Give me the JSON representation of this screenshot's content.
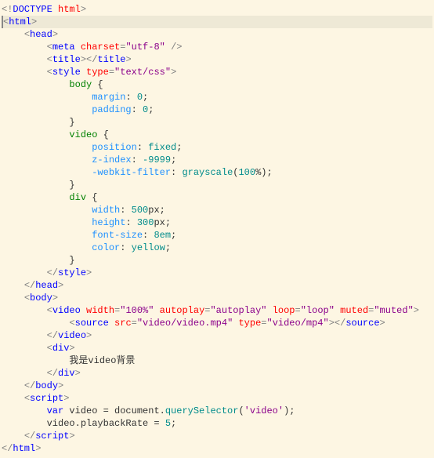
{
  "lines": [
    [
      [
        0,
        "&lt;!",
        "gray"
      ],
      [
        0,
        "DOCTYPE",
        "blue"
      ],
      [
        0,
        " ",
        "black"
      ],
      [
        0,
        "html",
        "red"
      ],
      [
        0,
        "&gt;",
        "gray"
      ]
    ],
    [
      [
        0,
        "&lt;",
        "gray"
      ],
      [
        0,
        "html",
        "blue"
      ],
      [
        0,
        "&gt;",
        "gray"
      ]
    ],
    [
      [
        4,
        "&lt;",
        "gray"
      ],
      [
        0,
        "head",
        "blue"
      ],
      [
        0,
        "&gt;",
        "gray"
      ]
    ],
    [
      [
        8,
        "&lt;",
        "gray"
      ],
      [
        0,
        "meta",
        "blue"
      ],
      [
        0,
        " ",
        "black"
      ],
      [
        0,
        "charset",
        "red"
      ],
      [
        0,
        "=",
        "gray"
      ],
      [
        0,
        "\"utf-8\"",
        "purple"
      ],
      [
        0,
        " /&gt;",
        "gray"
      ]
    ],
    [
      [
        8,
        "&lt;",
        "gray"
      ],
      [
        0,
        "title",
        "blue"
      ],
      [
        0,
        "&gt;&lt;/",
        "gray"
      ],
      [
        0,
        "title",
        "blue"
      ],
      [
        0,
        "&gt;",
        "gray"
      ]
    ],
    [
      [
        8,
        "&lt;",
        "gray"
      ],
      [
        0,
        "style",
        "blue"
      ],
      [
        0,
        " ",
        "black"
      ],
      [
        0,
        "type",
        "red"
      ],
      [
        0,
        "=",
        "gray"
      ],
      [
        0,
        "\"text/css\"",
        "purple"
      ],
      [
        0,
        "&gt;",
        "gray"
      ]
    ],
    [
      [
        12,
        "body",
        "green"
      ],
      [
        0,
        " {",
        "black"
      ]
    ],
    [
      [
        16,
        "margin",
        "lblue"
      ],
      [
        0,
        ": ",
        "black"
      ],
      [
        0,
        "0",
        "teal"
      ],
      [
        0,
        ";",
        "black"
      ]
    ],
    [
      [
        16,
        "padding",
        "lblue"
      ],
      [
        0,
        ": ",
        "black"
      ],
      [
        0,
        "0",
        "teal"
      ],
      [
        0,
        ";",
        "black"
      ]
    ],
    [
      [
        12,
        "}",
        "black"
      ]
    ],
    [
      [
        12,
        "video",
        "green"
      ],
      [
        0,
        " {",
        "black"
      ]
    ],
    [
      [
        16,
        "position",
        "lblue"
      ],
      [
        0,
        ": ",
        "black"
      ],
      [
        0,
        "fixed",
        "teal"
      ],
      [
        0,
        ";",
        "black"
      ]
    ],
    [
      [
        16,
        "z-index",
        "lblue"
      ],
      [
        0,
        ": ",
        "black"
      ],
      [
        0,
        "-9999",
        "teal"
      ],
      [
        0,
        ";",
        "black"
      ]
    ],
    [
      [
        16,
        "-webkit-filter",
        "lblue"
      ],
      [
        0,
        ": ",
        "black"
      ],
      [
        0,
        "grayscale",
        "teal"
      ],
      [
        0,
        "(",
        "black"
      ],
      [
        0,
        "100",
        "teal"
      ],
      [
        0,
        "%);",
        "black"
      ]
    ],
    [
      [
        12,
        "}",
        "black"
      ]
    ],
    [
      [
        12,
        "div",
        "green"
      ],
      [
        0,
        " {",
        "black"
      ]
    ],
    [
      [
        16,
        "width",
        "lblue"
      ],
      [
        0,
        ": ",
        "black"
      ],
      [
        0,
        "500",
        "teal"
      ],
      [
        0,
        "px;",
        "black"
      ]
    ],
    [
      [
        16,
        "height",
        "lblue"
      ],
      [
        0,
        ": ",
        "black"
      ],
      [
        0,
        "300",
        "teal"
      ],
      [
        0,
        "px;",
        "black"
      ]
    ],
    [
      [
        16,
        "font-size",
        "lblue"
      ],
      [
        0,
        ": ",
        "black"
      ],
      [
        0,
        "8em",
        "teal"
      ],
      [
        0,
        ";",
        "black"
      ]
    ],
    [
      [
        16,
        "color",
        "lblue"
      ],
      [
        0,
        ": ",
        "black"
      ],
      [
        0,
        "yellow",
        "teal"
      ],
      [
        0,
        ";",
        "black"
      ]
    ],
    [
      [
        12,
        "}",
        "black"
      ]
    ],
    [
      [
        8,
        "&lt;/",
        "gray"
      ],
      [
        0,
        "style",
        "blue"
      ],
      [
        0,
        "&gt;",
        "gray"
      ]
    ],
    [
      [
        4,
        "&lt;/",
        "gray"
      ],
      [
        0,
        "head",
        "blue"
      ],
      [
        0,
        "&gt;",
        "gray"
      ]
    ],
    [
      [
        4,
        "&lt;",
        "gray"
      ],
      [
        0,
        "body",
        "blue"
      ],
      [
        0,
        "&gt;",
        "gray"
      ]
    ],
    [
      [
        8,
        "&lt;",
        "gray"
      ],
      [
        0,
        "video",
        "blue"
      ],
      [
        0,
        " ",
        "black"
      ],
      [
        0,
        "width",
        "red"
      ],
      [
        0,
        "=",
        "gray"
      ],
      [
        0,
        "\"100%\"",
        "purple"
      ],
      [
        0,
        " ",
        "black"
      ],
      [
        0,
        "autoplay",
        "red"
      ],
      [
        0,
        "=",
        "gray"
      ],
      [
        0,
        "\"autoplay\"",
        "purple"
      ],
      [
        0,
        " ",
        "black"
      ],
      [
        0,
        "loop",
        "red"
      ],
      [
        0,
        "=",
        "gray"
      ],
      [
        0,
        "\"loop\"",
        "purple"
      ],
      [
        0,
        " ",
        "black"
      ],
      [
        0,
        "muted",
        "red"
      ],
      [
        0,
        "=",
        "gray"
      ],
      [
        0,
        "\"muted\"",
        "purple"
      ],
      [
        0,
        "&gt;",
        "gray"
      ]
    ],
    [
      [
        12,
        "&lt;",
        "gray"
      ],
      [
        0,
        "source",
        "blue"
      ],
      [
        0,
        " ",
        "black"
      ],
      [
        0,
        "src",
        "red"
      ],
      [
        0,
        "=",
        "gray"
      ],
      [
        0,
        "\"video/video.mp4\"",
        "purple"
      ],
      [
        0,
        " ",
        "black"
      ],
      [
        0,
        "type",
        "red"
      ],
      [
        0,
        "=",
        "gray"
      ],
      [
        0,
        "\"video/mp4\"",
        "purple"
      ],
      [
        0,
        "&gt;&lt;/",
        "gray"
      ],
      [
        0,
        "source",
        "blue"
      ],
      [
        0,
        "&gt;",
        "gray"
      ]
    ],
    [
      [
        8,
        "&lt;/",
        "gray"
      ],
      [
        0,
        "video",
        "blue"
      ],
      [
        0,
        "&gt;",
        "gray"
      ]
    ],
    [
      [
        8,
        "&lt;",
        "gray"
      ],
      [
        0,
        "div",
        "blue"
      ],
      [
        0,
        "&gt;",
        "gray"
      ]
    ],
    [
      [
        12,
        "我是video背景",
        "black"
      ]
    ],
    [
      [
        8,
        "&lt;/",
        "gray"
      ],
      [
        0,
        "div",
        "blue"
      ],
      [
        0,
        "&gt;",
        "gray"
      ]
    ],
    [
      [
        4,
        "&lt;/",
        "gray"
      ],
      [
        0,
        "body",
        "blue"
      ],
      [
        0,
        "&gt;",
        "gray"
      ]
    ],
    [
      [
        4,
        "&lt;",
        "gray"
      ],
      [
        0,
        "script",
        "blue"
      ],
      [
        0,
        "&gt;",
        "gray"
      ]
    ],
    [
      [
        8,
        "var",
        "blue"
      ],
      [
        0,
        " video = document.",
        "black"
      ],
      [
        0,
        "querySelector",
        "teal"
      ],
      [
        0,
        "(",
        "black"
      ],
      [
        0,
        "'video'",
        "purple"
      ],
      [
        0,
        ");",
        "black"
      ]
    ],
    [
      [
        8,
        "video.playbackRate = ",
        "black"
      ],
      [
        0,
        "5",
        "teal"
      ],
      [
        0,
        ";",
        "black"
      ]
    ],
    [
      [
        4,
        "&lt;/",
        "gray"
      ],
      [
        0,
        "script",
        "blue"
      ],
      [
        0,
        "&gt;",
        "gray"
      ]
    ],
    [
      [
        0,
        "&lt;/",
        "gray"
      ],
      [
        0,
        "html",
        "blue"
      ],
      [
        0,
        "&gt;",
        "gray"
      ]
    ]
  ],
  "highlight_line": 1
}
